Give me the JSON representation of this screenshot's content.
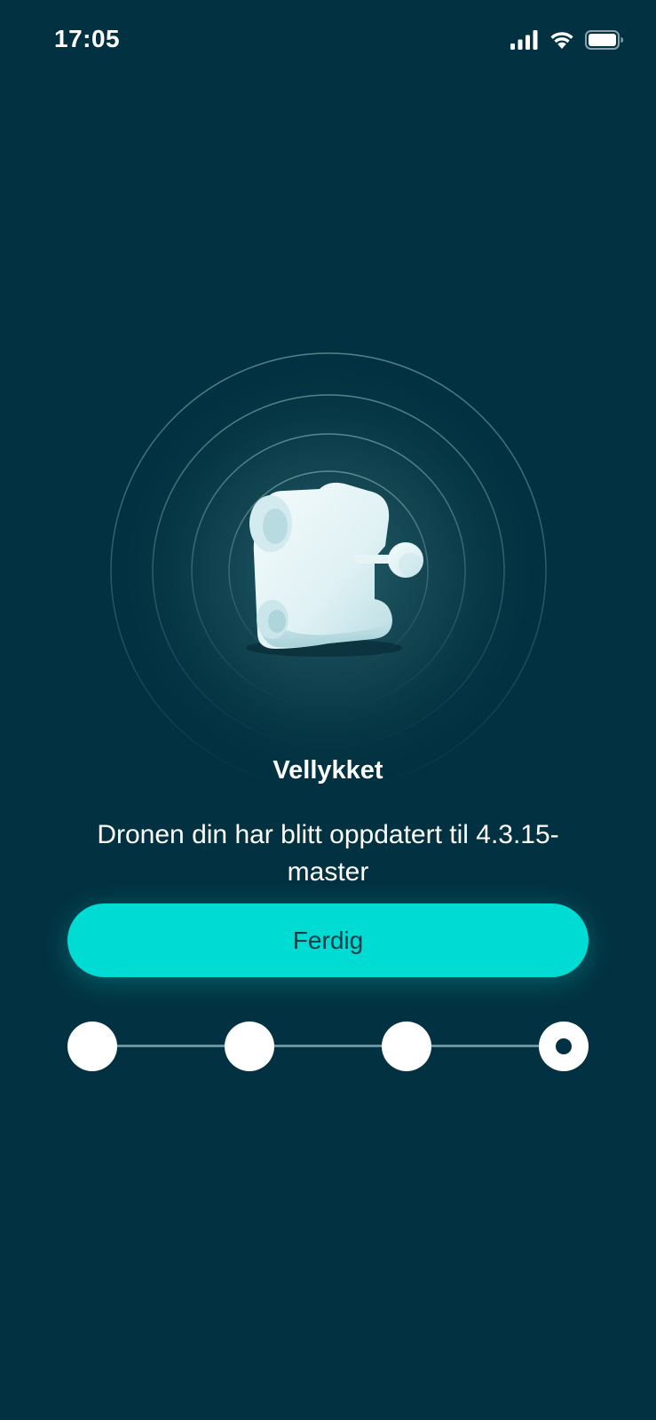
{
  "status_bar": {
    "time": "17:05",
    "icons": [
      "cellular-signal-icon",
      "wifi-icon",
      "battery-icon"
    ]
  },
  "hero": {
    "image": "drone-illustration"
  },
  "result": {
    "title": "Vellykket",
    "message": "Dronen din har blitt oppdatert til 4.3.15-master"
  },
  "actions": {
    "done_label": "Ferdig"
  },
  "stepper": {
    "total_steps": 4,
    "current_step": 4
  },
  "colors": {
    "background": "#023241",
    "accent": "#00dbd3",
    "button_text": "#0f3b46",
    "step_line": "#6e9298"
  }
}
